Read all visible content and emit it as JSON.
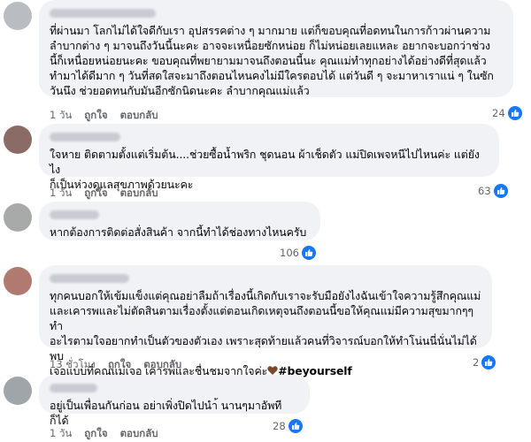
{
  "comments": [
    {
      "text": "ที่ผ่านมา โลกไม่ได้ใจดีกับเรา อุปสรรคต่าง ๆ มากมาย แต่ก็ขอบคุณที่อดทนในการก้าวผ่านความ\nลำบากต่าง ๆ มาจนถึงวันนี้นะคะ อาจจะเหนื่อยซักหน่อย ก็ไม่หน่อยเลยแหละ อยากจะบอกว่าช่วง\nนี้ก็เหนื่อยหน่อยนะคะ ขอบคุณที่พยายามมาจนถึงตอนนี้นะ คุณแม่ทำทุกอย่างได้อย่างดีที่สุดแล้ว\nทำมาได้ดีมาก ๆ วันที่สดใสจะมาถึงตอนไหนคงไม่มีใครตอบได้ แต่วันดี ๆ จะมาหาเราแน่ ๆ ในซัก\nวันนึง ช่วยอดทนกับมันอีกซักนิดนะคะ ลำบากคุณแม่แล้ว",
      "time": "1 วัน",
      "like": "ถูกใจ",
      "reply": "ตอบกลับ",
      "reactions": "24",
      "avatar_color": "#b9bcc0"
    },
    {
      "text": "ใจหาย ติดตามตั้งแต่เริ่มต้น....ช่วยซื้อน้ำพริก ชุดนอน ผ้าเช็ดตัว แม่ปิดเพจหนีไปไหนค่ะ แต่ยังไง\nก็เป็นห่วงดูแลสุขภาพด้วยนะคะ",
      "time": "1 วัน",
      "like": "ถูกใจ",
      "reply": "ตอบกลับ",
      "reactions": "63",
      "avatar_color": "#8a6b66"
    },
    {
      "text": "หากต้องการติดต่อสั่งสินค้า จากนี้ทำได้ช่องทางไหนครับ",
      "time": "1 วัน",
      "like": "ถูกใจ",
      "reply": "ตอบกลับ",
      "reactions": "106",
      "avatar_color": "#a7aaa8"
    },
    {
      "text_before_tag": "ทุกคนบอกให้เข้มแข็งแต่คุณอย่าลืมถ้าเรื่องนี้เกิดกับเราจะรับมือยังไงฉันเข้าใจความรู้สึกคุณแม่\nและเคารพและไม่ตัดสินตามเรื่องตั้งแต่ตอนเกิดเหตุจนถึงตอนนี้ขอให้คุณแม่มีความสุขมากๆๆทำ\nอะไรตามใจอยากทำเป็นตัวของตัวเอง เพราะสุดท้ายแล้วคนที่วิจารณ์บอกให้ทำโน่นนี่นั่นไม่ได้พบ\nเจอแบบที่คุณแม่เจอ เคารพและชื่นชมจากใจค่ะ",
      "hashtag": "#beyourself",
      "time": "13 ชั่วโมง",
      "like": "ถูกใจ",
      "reply": "ตอบกลับ",
      "reactions": "2",
      "avatar_color": "#b07a70"
    },
    {
      "text": "อยู่เป็นเพื่อนกันก่อน อย่าเพิ่งปิดไปนำ้ นานๆมาอัพทีก็ได้",
      "time": "1 วัน",
      "like": "ถูกใจ",
      "reply": "ตอบกลับ",
      "reactions": "28",
      "avatar_color": "#a0a5aa"
    }
  ],
  "colors": {
    "bubble": "#f0f2f5",
    "like_blue": "#1877f2",
    "meta": "#65676b",
    "heart": "#7b4a2e"
  },
  "icons": {
    "reaction": "like-thumb-icon",
    "emoji": "brown-heart-icon"
  }
}
